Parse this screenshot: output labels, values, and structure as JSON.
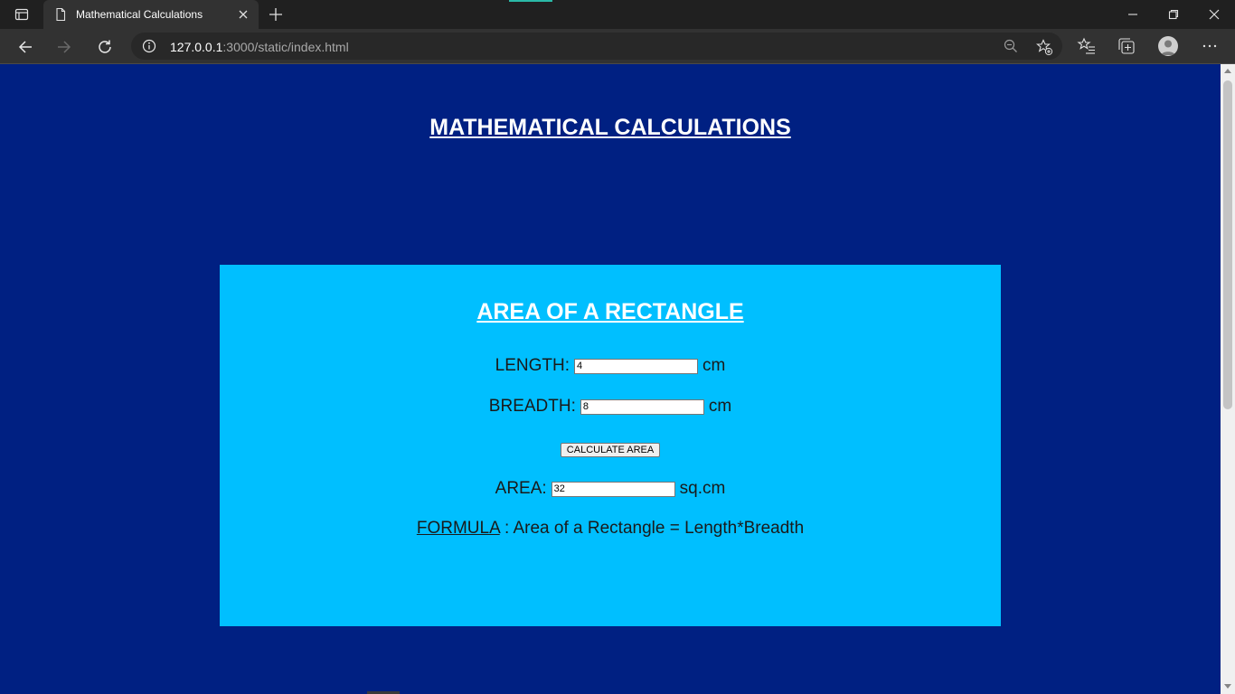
{
  "browser": {
    "tab": {
      "title": "Mathematical Calculations"
    },
    "url": {
      "host": "127.0.0.1",
      "path": ":3000/static/index.html"
    }
  },
  "page": {
    "heading": "MATHEMATICAL CALCULATIONS",
    "panel": {
      "title": "AREA OF A RECTANGLE",
      "length": {
        "label": "LENGTH:",
        "value": "4",
        "unit": "cm"
      },
      "breadth": {
        "label": "BREADTH:",
        "value": "8",
        "unit": "cm"
      },
      "calculate_button": "CALCULATE AREA",
      "area": {
        "label": "AREA:",
        "value": "32",
        "unit": "sq.cm"
      },
      "formula": {
        "key": "FORMULA",
        "text": " : Area of a Rectangle = Length*Breadth"
      }
    }
  },
  "colors": {
    "page_background": "#002082",
    "panel_background": "#00bfff",
    "browser_chrome": "#202020"
  }
}
